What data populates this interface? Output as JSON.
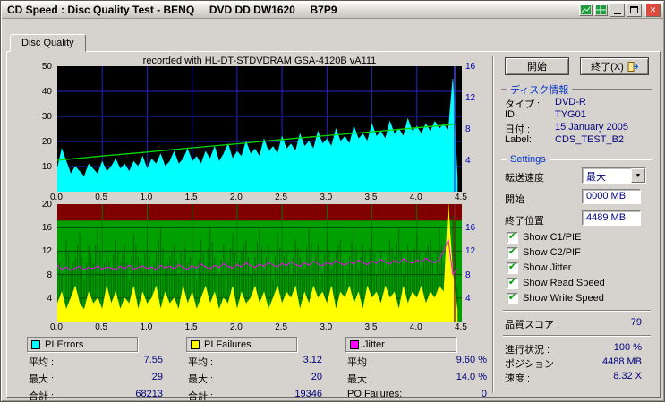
{
  "window": {
    "title": "CD Speed : Disc Quality Test - BENQ     DVD DD DW1620     B7P9"
  },
  "tabs": [
    {
      "label": "Disc Quality"
    }
  ],
  "legends": [
    {
      "title": "PI Errors",
      "color": "#00ffff",
      "rows": [
        {
          "label": "平均 :",
          "value": "7.55"
        },
        {
          "label": "最大 :",
          "value": "29"
        },
        {
          "label": "合計 :",
          "value": "68213"
        }
      ]
    },
    {
      "title": "PI Failures",
      "color": "#ffff00",
      "rows": [
        {
          "label": "平均 :",
          "value": "3.12"
        },
        {
          "label": "最大 :",
          "value": "20"
        },
        {
          "label": "合計 :",
          "value": "19346"
        }
      ]
    },
    {
      "title": "Jitter",
      "color": "#ff00ff",
      "rows": [
        {
          "label": "平均 :",
          "value": "9.60 %"
        },
        {
          "label": "最大 :",
          "value": "14.0 %"
        },
        {
          "label": "PO Failures:",
          "value": "0"
        }
      ]
    }
  ],
  "side": {
    "start_button": "開始",
    "exit_button": "終了(X)",
    "disc_info": {
      "header": "ディスク情報",
      "rows": [
        {
          "label": "タイプ :",
          "value": "DVD-R"
        },
        {
          "label": "ID:",
          "value": "TYG01"
        },
        {
          "label": "日付 :",
          "value": "15 January 2005"
        },
        {
          "label": "Label:",
          "value": "CDS_TEST_B2"
        }
      ]
    },
    "settings": {
      "header": "Settings",
      "speed_label": "転送速度",
      "speed_value": "最大",
      "start_label": "開始",
      "start_value": "0000 MB",
      "end_label": "終了位置",
      "end_value": "4489 MB",
      "checkboxes": [
        {
          "label": "Show C1/PIE",
          "checked": true
        },
        {
          "label": "Show C2/PIF",
          "checked": true
        },
        {
          "label": "Show Jitter",
          "checked": true
        },
        {
          "label": "Show Read Speed",
          "checked": true
        },
        {
          "label": "Show Write Speed",
          "checked": true
        }
      ]
    },
    "stats": {
      "score": {
        "label": "品質スコア :",
        "value": "79"
      },
      "progress": {
        "label": "進行状況 :",
        "value": "100 %"
      },
      "position": {
        "label": "ポジション :",
        "value": "4488 MB"
      },
      "speed": {
        "label": "速度 :",
        "value": "8.32 X"
      }
    }
  },
  "chart_data": [
    {
      "type": "area",
      "title": "recorded with HL-DT-STDVDRAM GSA-4120B vA111",
      "xlim": [
        0,
        4.5
      ],
      "x_ticks": [
        "0.0",
        "0.5",
        "1.0",
        "1.5",
        "2.0",
        "2.5",
        "3.0",
        "3.5",
        "4.0",
        "4.5"
      ],
      "ylim_left": [
        0,
        50
      ],
      "left_ticks": [
        50,
        40,
        30,
        20,
        10
      ],
      "ylim_right": [
        0,
        16
      ],
      "right_ticks": [
        16,
        12,
        8,
        4
      ],
      "bg_color": "#000000",
      "grid_color": "#2323cd",
      "cursor_x": 4.42,
      "series": [
        {
          "name": "PI Errors",
          "axis": "left",
          "color": "#00ffff",
          "fill": true,
          "x_step": 0.05,
          "values": [
            9,
            17,
            12,
            7,
            10,
            8,
            6,
            11,
            9,
            7,
            12,
            8,
            10,
            13,
            9,
            11,
            8,
            12,
            10,
            14,
            9,
            13,
            11,
            15,
            10,
            12,
            16,
            11,
            13,
            17,
            12,
            14,
            11,
            16,
            13,
            18,
            12,
            15,
            19,
            13,
            16,
            14,
            20,
            15,
            17,
            14,
            21,
            16,
            18,
            15,
            22,
            17,
            19,
            16,
            23,
            18,
            20,
            17,
            24,
            19,
            21,
            18,
            25,
            20,
            22,
            19,
            26,
            21,
            23,
            20,
            27,
            22,
            24,
            21,
            28,
            23,
            25,
            22,
            29,
            24,
            26,
            23,
            27,
            24,
            28,
            25,
            27,
            24,
            45,
            5
          ]
        },
        {
          "name": "Write Speed",
          "axis": "right",
          "color": "#00d800",
          "points": [
            [
              0,
              4.0
            ],
            [
              0.5,
              4.55
            ],
            [
              1.0,
              5.05
            ],
            [
              1.5,
              5.6
            ],
            [
              2.0,
              6.1
            ],
            [
              2.5,
              6.65
            ],
            [
              3.0,
              7.15
            ],
            [
              3.5,
              7.65
            ],
            [
              4.0,
              8.15
            ],
            [
              4.42,
              8.6
            ]
          ]
        }
      ]
    },
    {
      "type": "area",
      "xlim": [
        0,
        4.5
      ],
      "x_ticks": [
        "0.0",
        "0.5",
        "1.0",
        "1.5",
        "2.0",
        "2.5",
        "3.0",
        "3.5",
        "4.0",
        "4.5"
      ],
      "ylim": [
        0,
        20
      ],
      "left_ticks": [
        20,
        16,
        12,
        8,
        4
      ],
      "right_ticks": [
        16,
        12,
        8,
        4
      ],
      "bg_color": "#00a000",
      "grid_color": "#007800",
      "hgrid_color": "#004000",
      "danger_band": {
        "from": 17.2,
        "to": 20,
        "color": "#800000"
      },
      "cursor_x": 4.42,
      "series": [
        {
          "name": "C1/PIE",
          "type": "spikes",
          "color": "#006400",
          "x_step": 0.05,
          "values": [
            12,
            8,
            14,
            9,
            11,
            15,
            7,
            13,
            10,
            16,
            8,
            12,
            9,
            14,
            10,
            13,
            7,
            15,
            11,
            9,
            14,
            8,
            12,
            16,
            9,
            11,
            13,
            8,
            15,
            10,
            12,
            7,
            14,
            9,
            16,
            11,
            8,
            13,
            10,
            15,
            9,
            12,
            14,
            8,
            11,
            16,
            9,
            13,
            7,
            15,
            10,
            12,
            8,
            14,
            11,
            9,
            16,
            10,
            13,
            8,
            15,
            9,
            12,
            14,
            7,
            11,
            16,
            9,
            13,
            10,
            15,
            8,
            12,
            9,
            14,
            11,
            16,
            8,
            13,
            10,
            15,
            9,
            12,
            14,
            8,
            16,
            10,
            13,
            18,
            6
          ]
        },
        {
          "name": "PI Failures",
          "color": "#ffff00",
          "fill": true,
          "x_step": 0.05,
          "values": [
            3,
            5,
            2,
            4,
            6,
            3,
            2,
            5,
            3,
            4,
            2,
            6,
            3,
            5,
            2,
            4,
            3,
            6,
            2,
            5,
            3,
            4,
            6,
            2,
            5,
            3,
            4,
            2,
            6,
            3,
            5,
            2,
            4,
            6,
            3,
            5,
            2,
            4,
            3,
            6,
            2,
            5,
            3,
            4,
            6,
            3,
            5,
            2,
            4,
            6,
            3,
            5,
            4,
            6,
            2,
            5,
            3,
            6,
            4,
            5,
            3,
            6,
            2,
            5,
            4,
            6,
            3,
            5,
            2,
            6,
            4,
            5,
            3,
            6,
            4,
            5,
            2,
            6,
            3,
            5,
            4,
            6,
            3,
            5,
            4,
            6,
            5,
            20,
            8,
            2
          ]
        },
        {
          "name": "Jitter",
          "color": "#ff00ff",
          "x_step": 0.05,
          "values": [
            9.6,
            8.9,
            9.3,
            8.7,
            9.1,
            9.4,
            8.8,
            9.2,
            9.0,
            9.5,
            8.9,
            9.3,
            9.1,
            8.8,
            9.4,
            9.0,
            9.6,
            8.9,
            9.2,
            9.5,
            9.0,
            9.3,
            8.8,
            9.6,
            9.1,
            9.4,
            9.0,
            9.7,
            9.2,
            8.9,
            9.5,
            9.1,
            9.8,
            9.3,
            9.0,
            9.6,
            9.2,
            9.9,
            9.4,
            9.1,
            9.7,
            9.3,
            10.0,
            9.5,
            9.2,
            9.8,
            9.4,
            10.1,
            9.6,
            9.3,
            9.9,
            9.5,
            10.2,
            9.7,
            9.4,
            10.0,
            9.6,
            10.3,
            9.8,
            9.5,
            10.1,
            9.7,
            10.4,
            9.9,
            9.6,
            10.2,
            9.8,
            10.5,
            10.0,
            9.7,
            10.3,
            9.9,
            10.6,
            10.1,
            9.8,
            10.4,
            10.0,
            10.7,
            10.2,
            9.9,
            10.5,
            10.1,
            10.8,
            10.3,
            10.0,
            10.6,
            12.0,
            14.0,
            8.0,
            9.0
          ]
        }
      ]
    }
  ]
}
